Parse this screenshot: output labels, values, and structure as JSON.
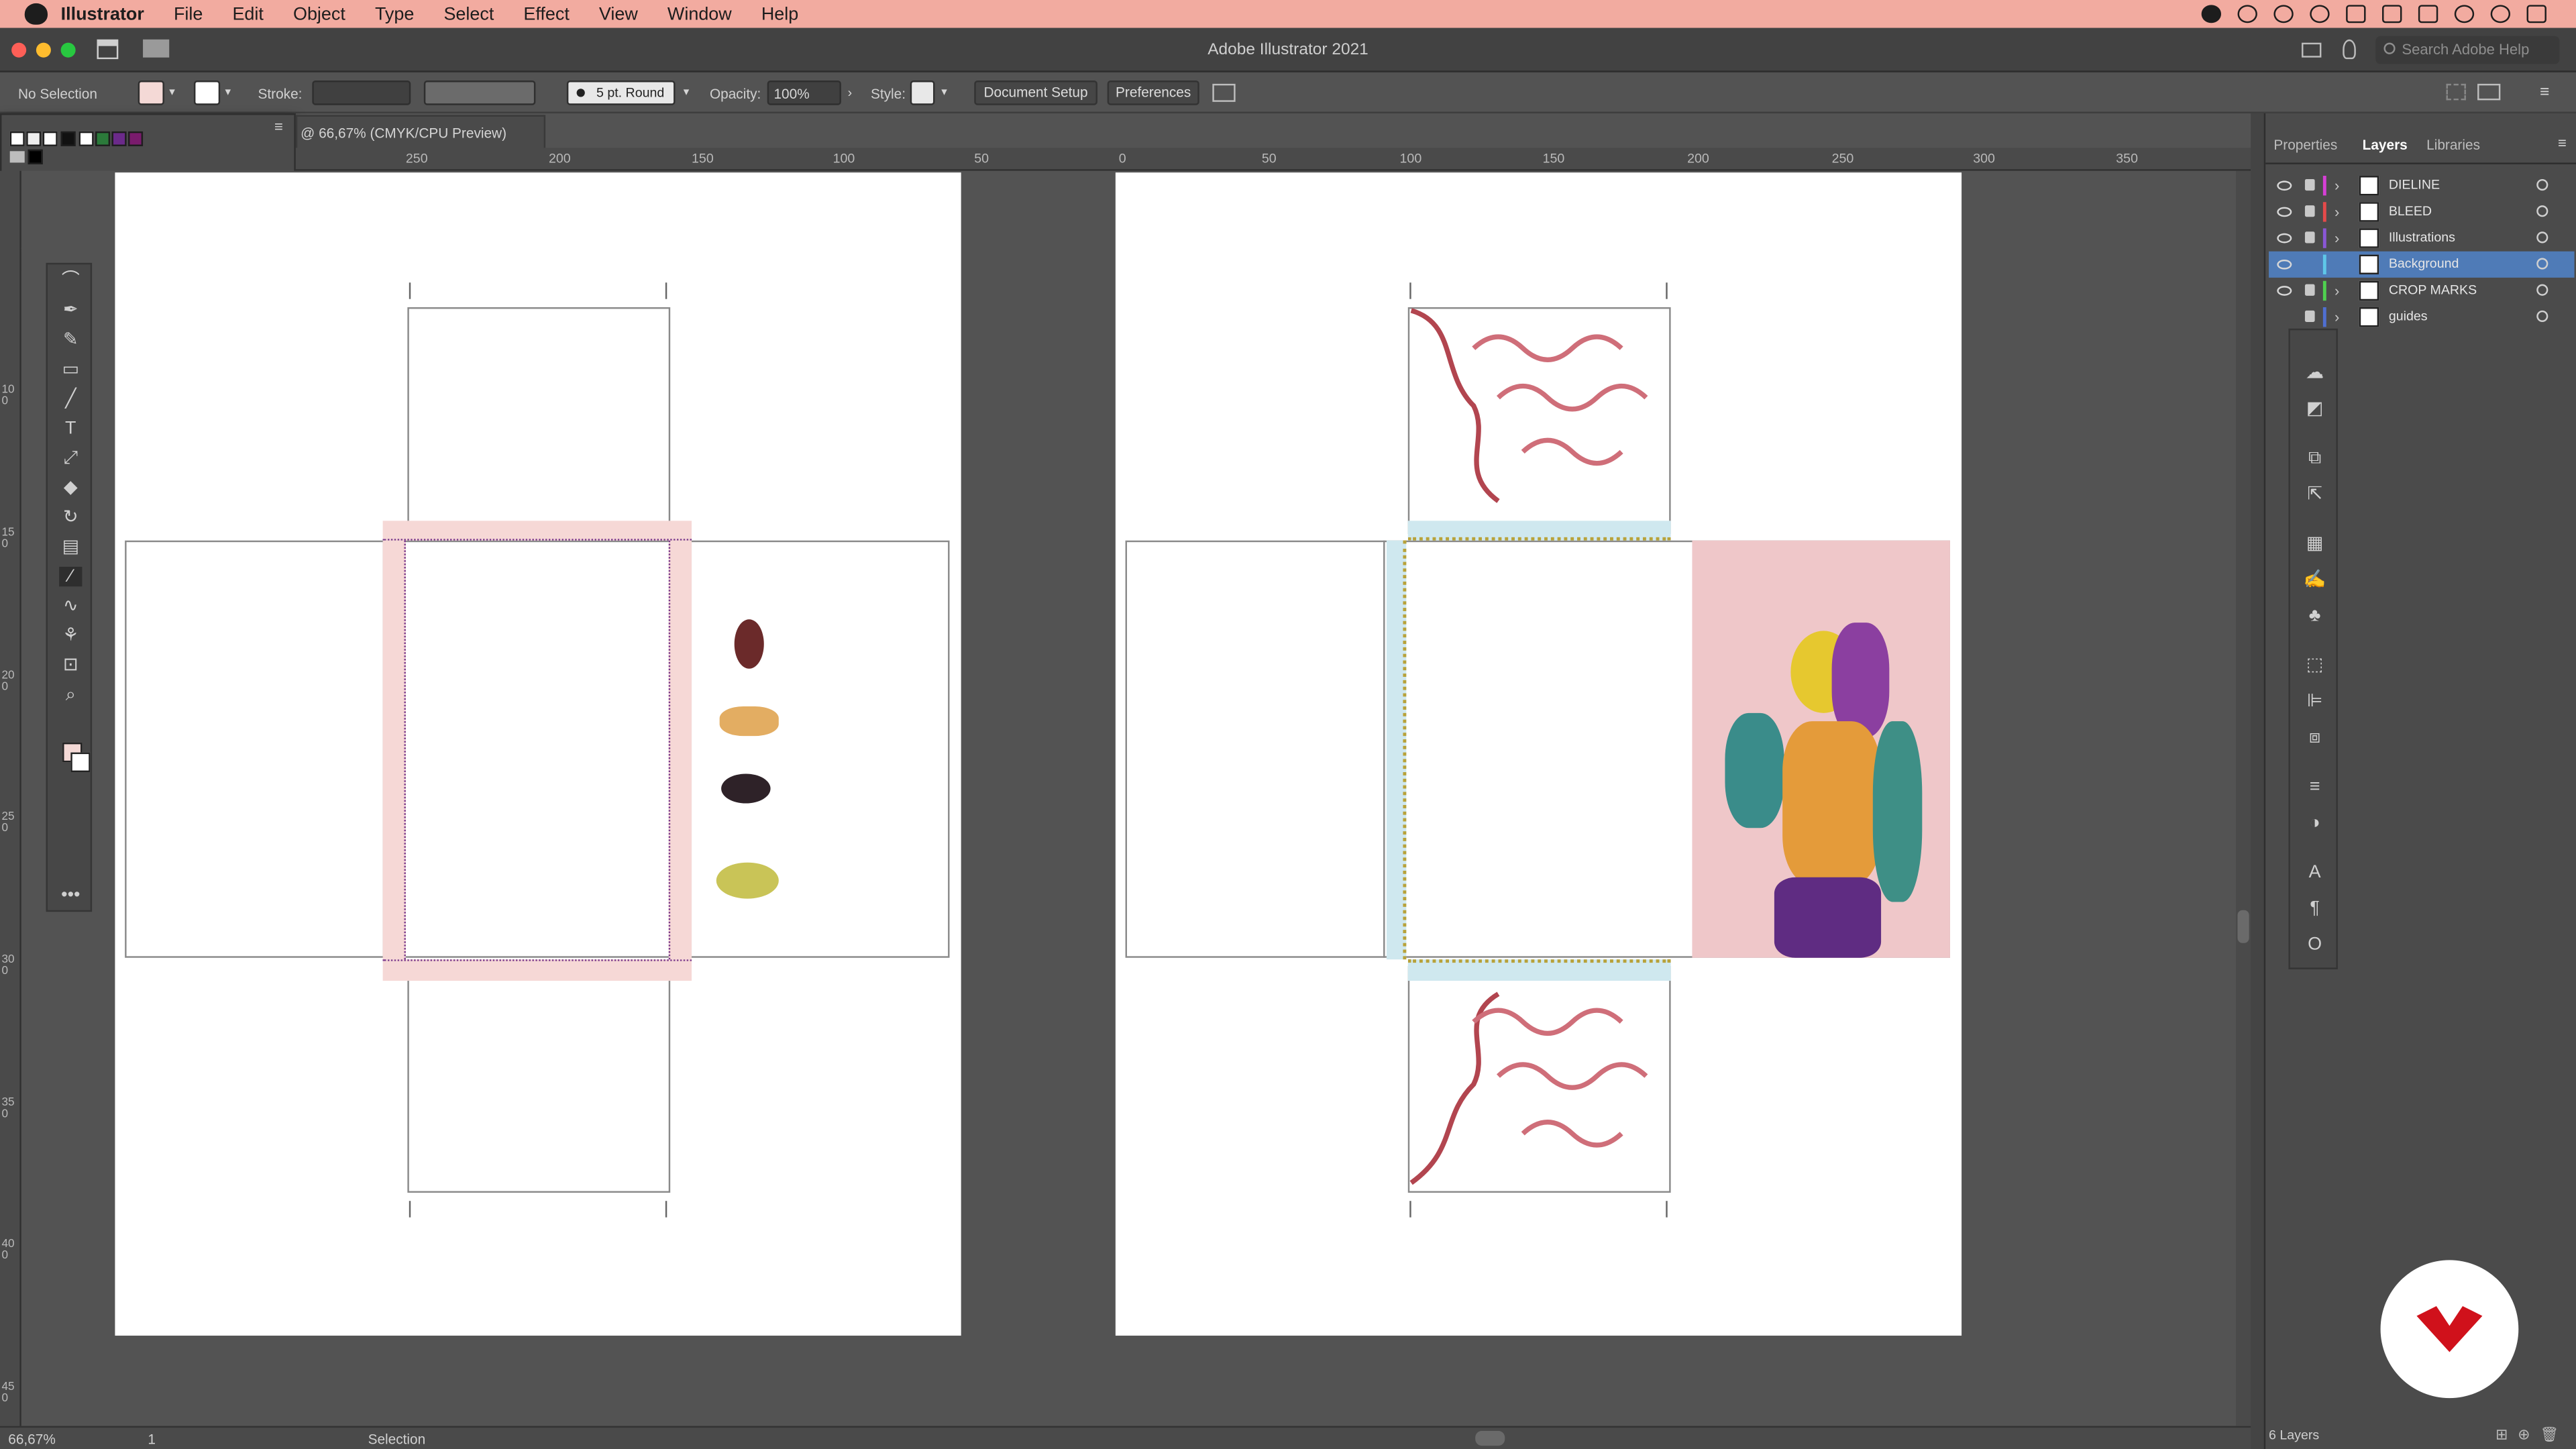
{
  "menubar": {
    "app_name": "Illustrator",
    "items": [
      "File",
      "Edit",
      "Object",
      "Type",
      "Select",
      "Effect",
      "View",
      "Window",
      "Help"
    ]
  },
  "titlebar": {
    "title": "Adobe Illustrator 2021",
    "search_placeholder": "Search Adobe Help"
  },
  "controlbar": {
    "selection": "No Selection",
    "stroke_label": "Stroke:",
    "brush": "5 pt. Round",
    "opacity_label": "Opacity:",
    "opacity_value": "100%",
    "style_label": "Style:",
    "document_setup": "Document Setup",
    "preferences": "Preferences"
  },
  "document": {
    "tab_label": "@ 66,67% (CMYK/CPU Preview)"
  },
  "rulers": {
    "horizontal": [
      "250",
      "200",
      "150",
      "100",
      "50",
      "0",
      "50",
      "100",
      "150",
      "200",
      "250",
      "300",
      "350"
    ],
    "vertical": [
      "100",
      "150",
      "200",
      "250",
      "300",
      "350",
      "400",
      "450"
    ]
  },
  "statusbar": {
    "zoom": "66,67%",
    "artboard": "1",
    "tool": "Selection"
  },
  "panels": {
    "tabs": [
      "Properties",
      "Layers",
      "Libraries"
    ],
    "active_tab": "Layers",
    "layers": [
      {
        "name": "DIELINE",
        "color": "#d63fd6",
        "visible": true,
        "locked": true,
        "selected": false
      },
      {
        "name": "BLEED",
        "color": "#e54a4a",
        "visible": true,
        "locked": true,
        "selected": false
      },
      {
        "name": "Illustrations",
        "color": "#8a57d6",
        "visible": true,
        "locked": true,
        "selected": false
      },
      {
        "name": "Background",
        "color": "#5fc7e8",
        "visible": true,
        "locked": false,
        "selected": true
      },
      {
        "name": "CROP MARKS",
        "color": "#4fd14f",
        "visible": true,
        "locked": true,
        "selected": false
      },
      {
        "name": "guides",
        "color": "#4f6fd1",
        "visible": false,
        "locked": true,
        "selected": false
      }
    ],
    "layers_count": "6 Layers"
  },
  "colors": {
    "menubar_bg": "#f2aba0",
    "ui_bg": "#535353",
    "selection_blue": "#4f7bb7",
    "brand_red": "#d0111b"
  }
}
